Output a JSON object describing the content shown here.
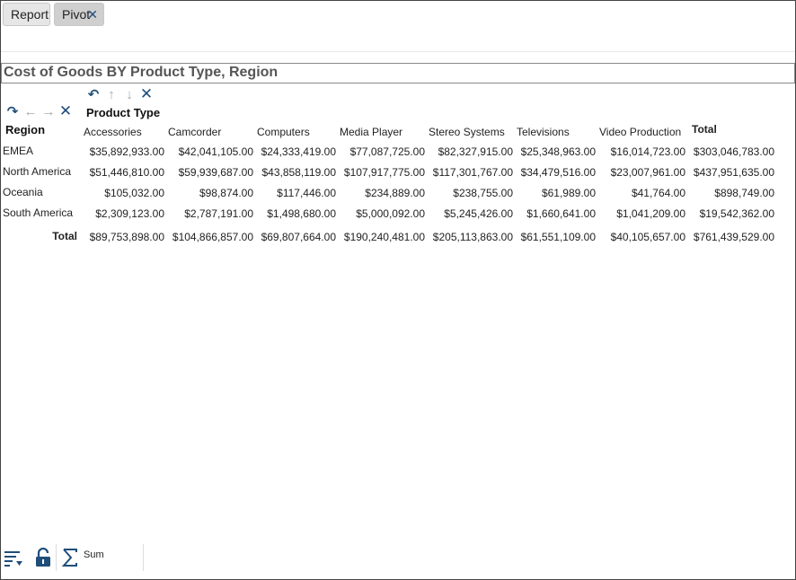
{
  "tabs": [
    {
      "label": "Report"
    },
    {
      "label": "Pivot",
      "close": "✕"
    }
  ],
  "title": "Cost of Goods BY Product Type, Region",
  "toolbar": {
    "column_dim_label": "Product Type",
    "row_dim_label": "Region",
    "col_icons": [
      "undo-rotate-icon",
      "arrow-up-icon",
      "arrow-down-icon",
      "remove-x-icon"
    ],
    "row_icons": [
      "redo-rotate-icon",
      "arrow-left-icon",
      "arrow-right-icon",
      "remove-x-icon"
    ]
  },
  "pivot": {
    "columns": [
      "Accessories",
      "Camcorder",
      "Computers",
      "Media Player",
      "Stereo Systems",
      "Televisions",
      "Video Production",
      "Total"
    ],
    "rows": [
      {
        "label": "EMEA",
        "values": [
          "$35,892,933.00",
          "$42,041,105.00",
          "$24,333,419.00",
          "$77,087,725.00",
          "$82,327,915.00",
          "$25,348,963.00",
          "$16,014,723.00",
          "$303,046,783.00"
        ]
      },
      {
        "label": "North America",
        "values": [
          "$51,446,810.00",
          "$59,939,687.00",
          "$43,858,119.00",
          "$107,917,775.00",
          "$117,301,767.00",
          "$34,479,516.00",
          "$23,007,961.00",
          "$437,951,635.00"
        ]
      },
      {
        "label": "Oceania",
        "values": [
          "$105,032.00",
          "$98,874.00",
          "$117,446.00",
          "$234,889.00",
          "$238,755.00",
          "$61,989.00",
          "$41,764.00",
          "$898,749.00"
        ]
      },
      {
        "label": "South America",
        "values": [
          "$2,309,123.00",
          "$2,787,191.00",
          "$1,498,680.00",
          "$5,000,092.00",
          "$5,245,426.00",
          "$1,660,641.00",
          "$1,041,209.00",
          "$19,542,362.00"
        ]
      }
    ],
    "total_row": {
      "label": "Total",
      "values": [
        "$89,753,898.00",
        "$104,866,857.00",
        "$69,807,664.00",
        "$190,240,481.00",
        "$205,113,863.00",
        "$61,551,109.00",
        "$40,105,657.00",
        "$761,439,529.00"
      ]
    }
  },
  "bottom_bar": {
    "sum_label": "Sum",
    "icons": [
      "sort-icon",
      "lock-icon",
      "sigma-icon"
    ]
  }
}
